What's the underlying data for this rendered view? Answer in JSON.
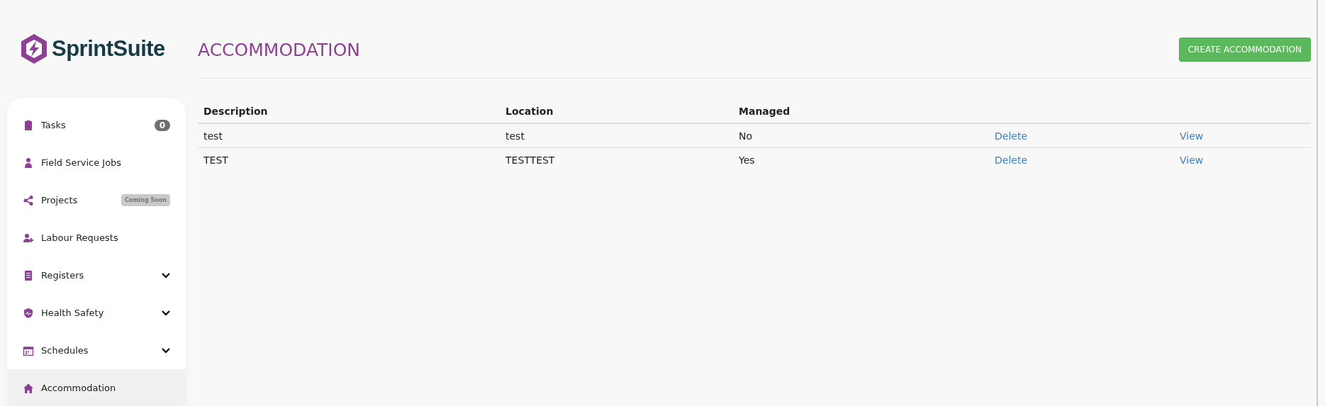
{
  "logo": {
    "text": "SprintSuite"
  },
  "sidebar": {
    "items": [
      {
        "label": "Tasks",
        "badge": {
          "text": "0",
          "kind": "count"
        },
        "selected": false
      },
      {
        "label": "Field Service Jobs",
        "selected": false
      },
      {
        "label": "Projects",
        "badge": {
          "text": "Coming Soon",
          "kind": "pill"
        },
        "selected": false
      },
      {
        "label": "Labour Requests",
        "selected": false
      },
      {
        "label": "Registers",
        "expanded": false,
        "selected": false
      },
      {
        "label": "Health Safety",
        "expanded": false,
        "selected": false
      },
      {
        "label": "Schedules",
        "expanded": false,
        "selected": false
      },
      {
        "label": "Accommodation",
        "selected": true
      }
    ]
  },
  "page": {
    "title": "ACCOMMODATION",
    "create_button": "CREATE ACCOMMODATION"
  },
  "table": {
    "columns": [
      "Description",
      "Location",
      "Managed"
    ],
    "rows": [
      {
        "cells": [
          "test",
          "test",
          "No"
        ],
        "actions": [
          "Delete",
          "View"
        ]
      },
      {
        "cells": [
          "TEST",
          "TESTTEST",
          "Yes"
        ],
        "actions": [
          "Delete",
          "View"
        ]
      }
    ]
  }
}
